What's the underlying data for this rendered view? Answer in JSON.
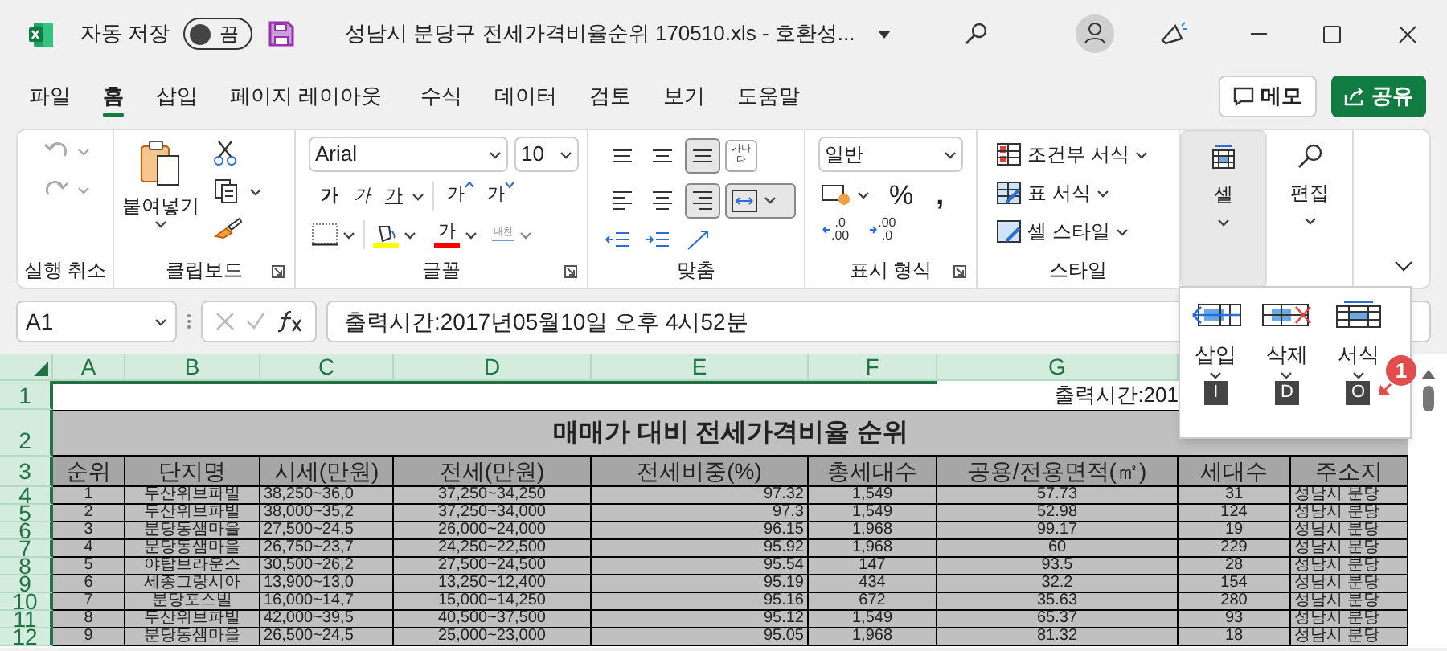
{
  "window": {
    "autosave_label": "자동 저장",
    "autosave": {
      "label": "끔",
      "on": false
    },
    "title": "성남시 분당구 전세가격비율순위 170510.xls - 호환성..."
  },
  "menu_tabs": [
    {
      "label": "파일",
      "selected": false
    },
    {
      "label": "홈",
      "selected": true
    },
    {
      "label": "삽입",
      "selected": false
    },
    {
      "label": "페이지 레이아웃",
      "selected": false
    },
    {
      "label": "수식",
      "selected": false
    },
    {
      "label": "데이터",
      "selected": false
    },
    {
      "label": "검토",
      "selected": false
    },
    {
      "label": "보기",
      "selected": false
    },
    {
      "label": "도움말",
      "selected": false
    }
  ],
  "memo_button": {
    "label": "메모"
  },
  "share_button": {
    "label": "공유"
  },
  "ribbon": {
    "undo_group": {
      "label": "실행 취소"
    },
    "clipboard": {
      "paste_label": "붙여넣기",
      "label": "클립보드"
    },
    "font": {
      "name": "Arial",
      "size": "10",
      "style_buttons": [
        {
          "kind": "bold",
          "label": "가"
        },
        {
          "kind": "italic",
          "label": "가"
        },
        {
          "kind": "underline",
          "label": "가"
        }
      ],
      "size_buttons": [
        {
          "kind": "grow",
          "label": "가"
        },
        {
          "kind": "shrink",
          "label": "가"
        }
      ],
      "font_color_label": "가",
      "phonetic_label": "내천",
      "label": "글꼴"
    },
    "alignment": {
      "align_buttons": [
        {
          "kind": "top",
          "selected": false
        },
        {
          "kind": "middle",
          "selected": false
        },
        {
          "kind": "bottom",
          "selected": true
        },
        {
          "kind": "left",
          "selected": false
        },
        {
          "kind": "center",
          "selected": false
        },
        {
          "kind": "right",
          "selected": true
        }
      ],
      "wrap_label": "가나다",
      "merge": {
        "selected": true
      },
      "label": "맞춤"
    },
    "number": {
      "format": "일반",
      "percent": "%",
      "comma": ",",
      "decimal_buttons": [
        {
          "kind": "increase",
          "top": ".0",
          "bottom": ".00"
        },
        {
          "kind": "decrease",
          "top": ".00",
          "bottom": ".0"
        }
      ],
      "label": "표시 형식"
    },
    "styles": {
      "items": [
        {
          "kind": "conditional",
          "label": "조건부 서식"
        },
        {
          "kind": "table",
          "label": "표 서식"
        },
        {
          "kind": "cell",
          "label": "셀 스타일"
        }
      ],
      "label": "스타일"
    },
    "cells": {
      "label": "셀",
      "selected": true
    },
    "editing": {
      "label": "편집"
    }
  },
  "formula_bar": {
    "name_box": "A1",
    "content": "출력시간:2017년05월10일 오후 4시52분"
  },
  "sheet": {
    "columns": [
      "A",
      "B",
      "C",
      "D",
      "E",
      "F",
      "G"
    ],
    "row_numbers": [
      "1",
      "2",
      "3",
      "4",
      "5",
      "6",
      "7",
      "8",
      "9",
      "10",
      "11",
      "12"
    ],
    "print_time": "출력시간:201",
    "title": "매매가 대비 전세가격비율 순위",
    "headers": [
      "순위",
      "단지명",
      "시세(만원)",
      "전세(만원)",
      "전세비중(%)",
      "총세대수",
      "공용/전용면적(㎡)",
      "세대수",
      "주소지"
    ],
    "rows": [
      [
        "1",
        "두산위브파빌",
        "38,250~36,0",
        "37,250~34,250",
        "97.32",
        "1,549",
        "57.73",
        "31",
        "성남시 분당"
      ],
      [
        "2",
        "두산위브파빌",
        "38,000~35,2",
        "37,250~34,000",
        "97.3",
        "1,549",
        "52.98",
        "124",
        "성남시 분당"
      ],
      [
        "3",
        "분당동샘마을",
        "27,500~24,5",
        "26,000~24,000",
        "96.15",
        "1,968",
        "99.17",
        "19",
        "성남시 분당"
      ],
      [
        "4",
        "분당동샘마을",
        "26,750~23,7",
        "24,250~22,500",
        "95.92",
        "1,968",
        "60",
        "229",
        "성남시 분당"
      ],
      [
        "5",
        "야탑브라운스",
        "30,500~26,2",
        "27,500~24,500",
        "95.54",
        "147",
        "93.5",
        "28",
        "성남시 분당"
      ],
      [
        "6",
        "세종그랑시아",
        "13,900~13,0",
        "13,250~12,400",
        "95.19",
        "434",
        "32.2",
        "154",
        "성남시 분당"
      ],
      [
        "7",
        "분당포스빌",
        "16,000~14,7",
        "15,000~14,250",
        "95.16",
        "672",
        "35.63",
        "280",
        "성남시 분당"
      ],
      [
        "8",
        "두산위브파빌",
        "42,000~39,5",
        "40,500~37,500",
        "95.12",
        "1,549",
        "65.37",
        "93",
        "성남시 분당"
      ],
      [
        "9",
        "분당동샘마을",
        "26,500~24,5",
        "25,000~23,000",
        "95.05",
        "1,968",
        "81.32",
        "18",
        "성남시 분당"
      ]
    ]
  },
  "cells_menu": {
    "items": [
      {
        "kind": "insert",
        "label": "삽입",
        "keytip": "I"
      },
      {
        "kind": "delete",
        "label": "삭제",
        "keytip": "D"
      },
      {
        "kind": "format",
        "label": "서식",
        "keytip": "O"
      }
    ],
    "callout": "1"
  }
}
